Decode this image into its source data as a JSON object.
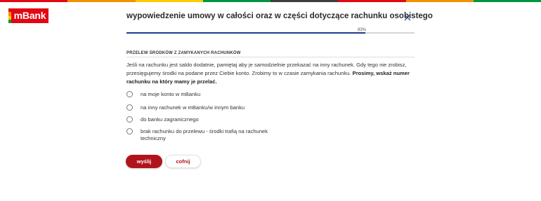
{
  "brand": {
    "logo_text": "mBank",
    "logo_color": "#e30613",
    "stripe_colors": [
      "#e30613",
      "#f39200",
      "#ffcc00",
      "#009640",
      "#3c3c3b"
    ]
  },
  "header": {
    "title": "wypowiedzenie umowy w całości oraz w części dotyczące rachunku osobistego",
    "close_icon": "close-icon"
  },
  "progress": {
    "value": 83,
    "label": "83%",
    "fill_color": "#1f3c88"
  },
  "section": {
    "heading": "PRZELEW ŚRODKÓW Z ZAMYKANYCH RACHUNKÓW",
    "description": "Jeśli na rachunku jest saldo dodatnie, pamiętaj aby je samodzielnie przekazać na inny rachunek. Gdy tego nie zrobisz, przesięgujemy środki na podane przez Ciebie konto. Zrobimy to w czasie zamykania rachunku. ",
    "description_bold": "Prosimy, wskaż numer rachunku na który mamy je przelać."
  },
  "options": [
    {
      "label": "na moje konto w mBanku"
    },
    {
      "label": "na inny rachunek w mBanku/w innym banku"
    },
    {
      "label": "do banku zagranicznego"
    },
    {
      "label": "brak rachunku do przelewu - środki trafią na rachunek techniczny"
    }
  ],
  "buttons": {
    "send_label": "wyślij",
    "back_label": "cofnij",
    "primary_color": "#b0141a"
  }
}
